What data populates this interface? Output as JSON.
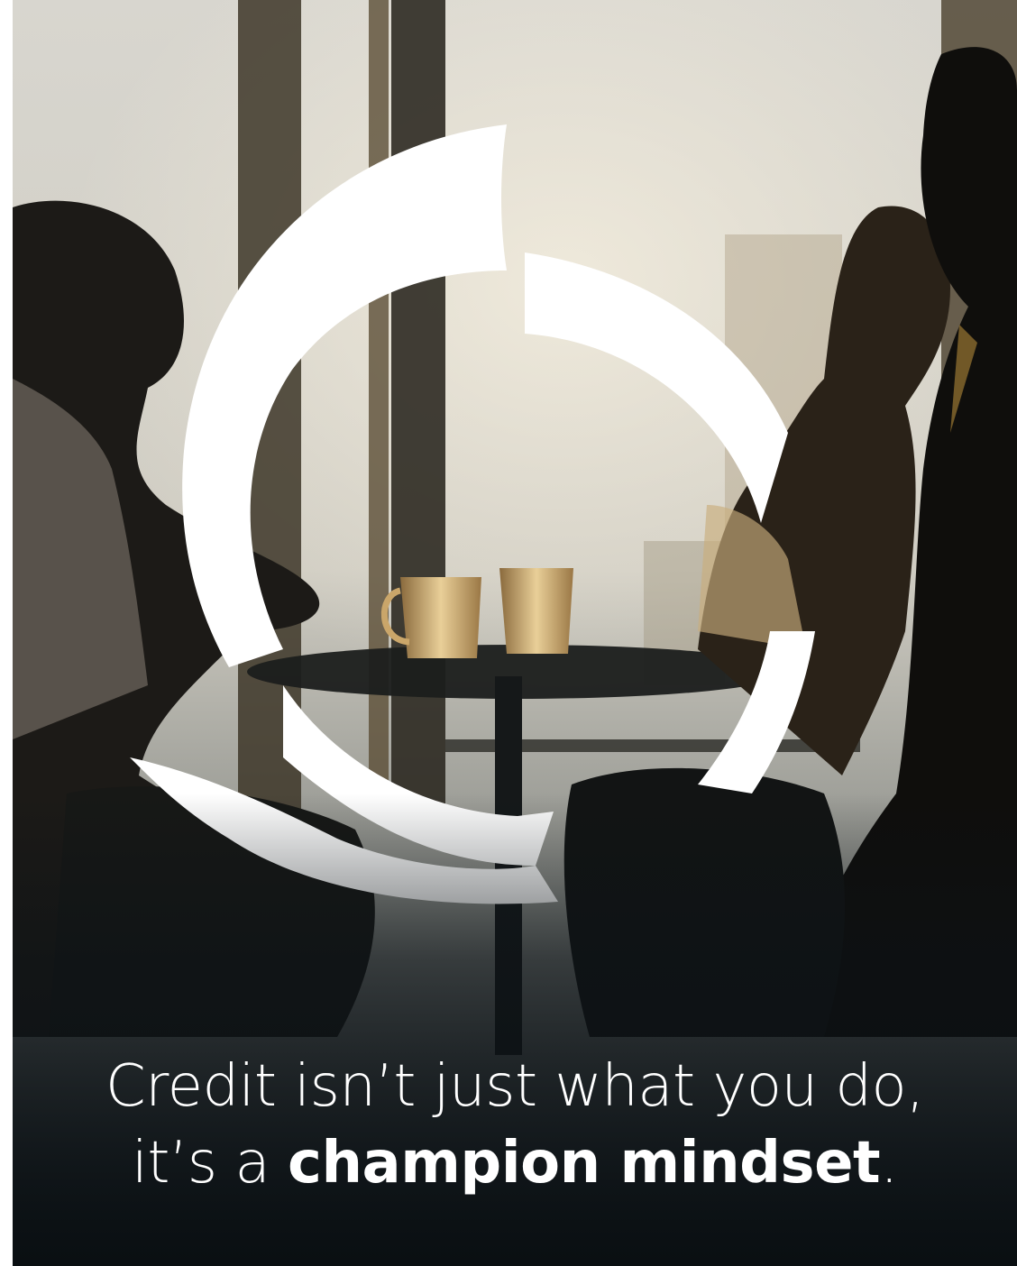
{
  "poster": {
    "headline": {
      "line1": "Credit isn’t just what you do,",
      "line2_prefix": "it’s a ",
      "line2_emphasis": "champion mindset",
      "line2_suffix": "."
    },
    "colors": {
      "text": "#ffffff",
      "dark_base": "#0e1418",
      "ring": "#ffffff",
      "window_light": "#d9d7cf",
      "warm_highlight": "#c9a56b"
    },
    "logo": {
      "icon": "circular-ring-mark-icon"
    }
  }
}
